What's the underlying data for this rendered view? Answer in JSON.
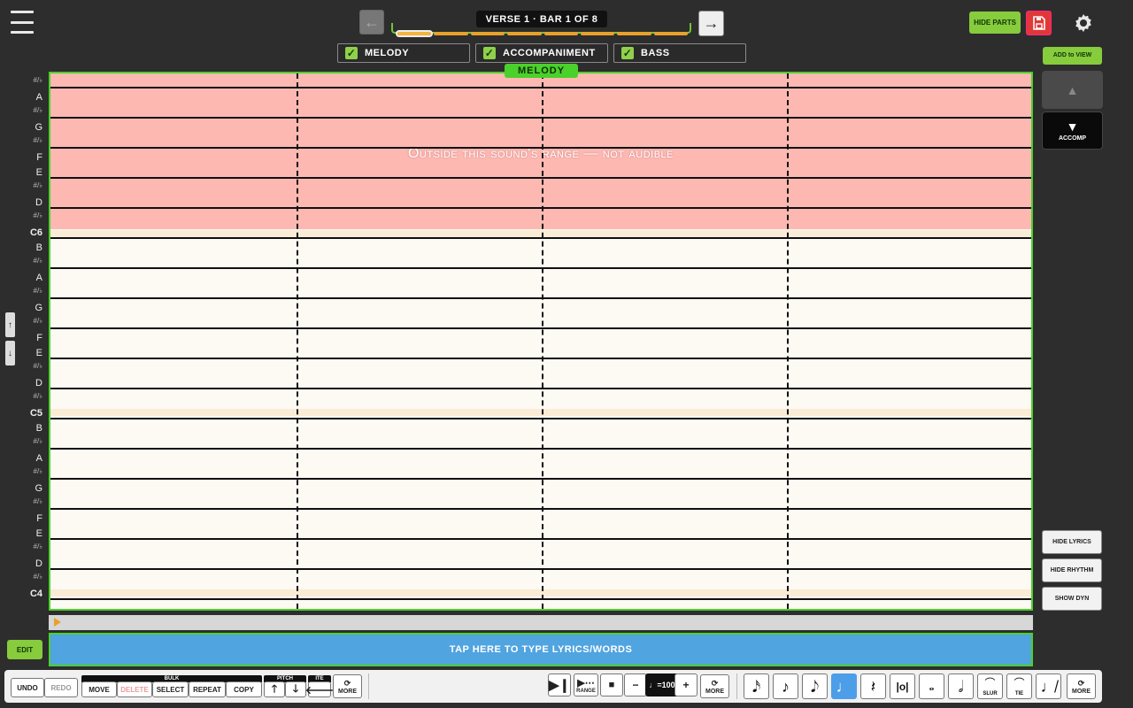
{
  "header": {
    "section_title": "VERSE 1 · BAR 1 OF 8",
    "prev_arrow": "←",
    "next_arrow": "→",
    "bar_count": 8,
    "current_bar": 1,
    "hide_parts_label": "HIDE PARTS"
  },
  "parts": [
    {
      "label": "MELODY",
      "checked": true
    },
    {
      "label": "ACCOMPANIMENT",
      "checked": true
    },
    {
      "label": "BASS",
      "checked": true
    }
  ],
  "staff": {
    "active_part_label": "MELODY",
    "out_of_range_message": "Outside this sound's range — not audible",
    "key_labels": [
      {
        "text": "#/♭",
        "type": "acc"
      },
      {
        "text": "A",
        "type": "note"
      },
      {
        "text": "#/♭",
        "type": "acc"
      },
      {
        "text": "G",
        "type": "note"
      },
      {
        "text": "#/♭",
        "type": "acc"
      },
      {
        "text": "F",
        "type": "note"
      },
      {
        "text": "E",
        "type": "note"
      },
      {
        "text": "#/♭",
        "type": "acc"
      },
      {
        "text": "D",
        "type": "note"
      },
      {
        "text": "#/♭",
        "type": "acc"
      },
      {
        "text": "C6",
        "type": "c"
      },
      {
        "text": "B",
        "type": "note"
      },
      {
        "text": "#/♭",
        "type": "acc"
      },
      {
        "text": "A",
        "type": "note"
      },
      {
        "text": "#/♭",
        "type": "acc"
      },
      {
        "text": "G",
        "type": "note"
      },
      {
        "text": "#/♭",
        "type": "acc"
      },
      {
        "text": "F",
        "type": "note"
      },
      {
        "text": "E",
        "type": "note"
      },
      {
        "text": "#/♭",
        "type": "acc"
      },
      {
        "text": "D",
        "type": "note"
      },
      {
        "text": "#/♭",
        "type": "acc"
      },
      {
        "text": "C5",
        "type": "c"
      },
      {
        "text": "B",
        "type": "note"
      },
      {
        "text": "#/♭",
        "type": "acc"
      },
      {
        "text": "A",
        "type": "note"
      },
      {
        "text": "#/♭",
        "type": "acc"
      },
      {
        "text": "G",
        "type": "note"
      },
      {
        "text": "#/♭",
        "type": "acc"
      },
      {
        "text": "F",
        "type": "note"
      },
      {
        "text": "E",
        "type": "note"
      },
      {
        "text": "#/♭",
        "type": "acc"
      },
      {
        "text": "D",
        "type": "note"
      },
      {
        "text": "#/♭",
        "type": "acc"
      },
      {
        "text": "C4",
        "type": "c"
      }
    ],
    "scroll_up": "↑",
    "scroll_down": "↓"
  },
  "right_panel": {
    "add_to_view": "ADD to VIEW",
    "part_up_arrow": "▲",
    "part_down_arrow": "▼",
    "part_down_label": "ACCOMP",
    "hide_lyrics": "HIDE LYRICS",
    "hide_rhythm": "HIDE RHYTHM",
    "show_dyn": "SHOW DYN"
  },
  "lyrics": {
    "prompt": "TAP HERE TO TYPE LYRICS/WORDS"
  },
  "edit_label": "EDIT",
  "toolbar": {
    "undo": "UNDO",
    "redo": "REDO",
    "bulk_group": "BULK",
    "move": "MOVE",
    "delete": "DELETE",
    "select": "SELECT",
    "repeat": "REPEAT",
    "copy": "COPY",
    "pitch_group": "PITCH",
    "item_group": "ITE",
    "more": "MORE",
    "range": "RANGE",
    "tempo_minus": "−",
    "tempo": "♩=100",
    "tempo_plus": "+",
    "slur": "SLUR",
    "tie": "TIE"
  },
  "colors": {
    "accent_green": "#86cc3c",
    "staff_border": "#4bd12b",
    "out_of_range": "#fdb8b2",
    "lyrics_blue": "#50a4e0",
    "progress_orange": "#e8a12a",
    "save_red": "#e23737"
  }
}
